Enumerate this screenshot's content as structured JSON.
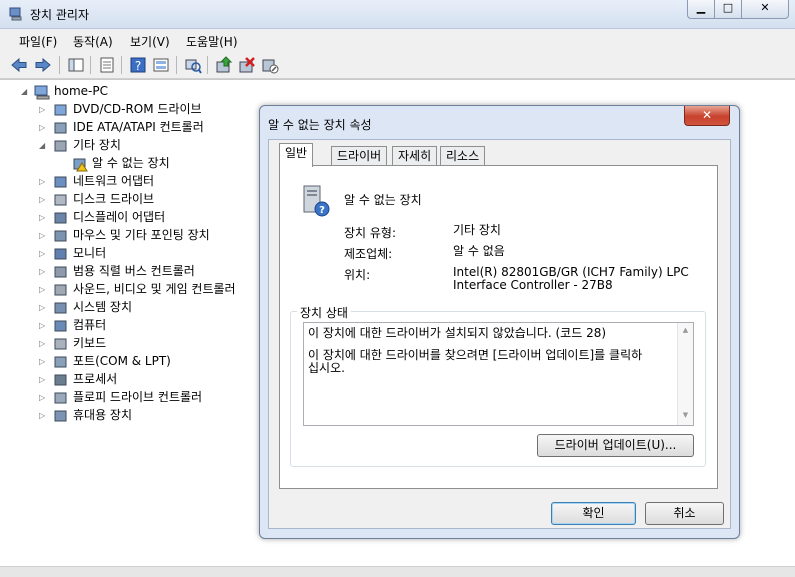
{
  "window": {
    "title": "장치 관리자",
    "controls": {
      "minimize": "▭",
      "maximize": "□",
      "close": "✕"
    }
  },
  "menu": [
    "파일(F)",
    "동작(A)",
    "보기(V)",
    "도움말(H)"
  ],
  "toolbar_icons": [
    "back-icon",
    "forward-icon",
    "show-hide-tree-icon",
    "properties-icon",
    "help-icon",
    "scan-hardware-icon",
    "update-driver-icon",
    "uninstall-icon",
    "disable-icon"
  ],
  "tree": {
    "root": "home-PC",
    "items": [
      {
        "label": "DVD/CD-ROM 드라이브",
        "icon": "dvd-drive-icon"
      },
      {
        "label": "IDE ATA/ATAPI 컨트롤러",
        "icon": "ide-controller-icon"
      },
      {
        "label": "기타 장치",
        "icon": "other-devices-icon",
        "expanded": true
      },
      {
        "label": "알 수 없는 장치",
        "icon": "unknown-device-warning-icon",
        "child": true
      },
      {
        "label": "네트워크 어댑터",
        "icon": "network-adapter-icon"
      },
      {
        "label": "디스크 드라이브",
        "icon": "disk-drive-icon"
      },
      {
        "label": "디스플레이 어댑터",
        "icon": "display-adapter-icon"
      },
      {
        "label": "마우스 및 기타 포인팅 장치",
        "icon": "mouse-icon"
      },
      {
        "label": "모니터",
        "icon": "monitor-icon"
      },
      {
        "label": "범용 직렬 버스 컨트롤러",
        "icon": "usb-icon"
      },
      {
        "label": "사운드, 비디오 및 게임 컨트롤러",
        "icon": "sound-icon"
      },
      {
        "label": "시스템 장치",
        "icon": "system-device-icon"
      },
      {
        "label": "컴퓨터",
        "icon": "computer-icon"
      },
      {
        "label": "키보드",
        "icon": "keyboard-icon"
      },
      {
        "label": "포트(COM & LPT)",
        "icon": "port-icon"
      },
      {
        "label": "프로세서",
        "icon": "processor-icon"
      },
      {
        "label": "플로피 드라이브 컨트롤러",
        "icon": "floppy-controller-icon"
      },
      {
        "label": "휴대용 장치",
        "icon": "portable-device-icon"
      }
    ]
  },
  "dialog": {
    "title": "알 수 없는 장치 속성",
    "close": "✕",
    "tabs": [
      "일반",
      "드라이버",
      "자세히",
      "리소스"
    ],
    "device_name": "알 수 없는 장치",
    "props": {
      "type_label": "장치 유형:",
      "type_value": "기타 장치",
      "manufacturer_label": "제조업체:",
      "manufacturer_value": "알 수 없음",
      "location_label": "위치:",
      "location_value_1": "Intel(R) 82801GB/GR (ICH7 Family) LPC",
      "location_value_2": "Interface Controller - 27B8"
    },
    "status_group": "장치 상태",
    "status_line1": "이 장치에 대한 드라이버가 설치되지 않았습니다. (코드 28)",
    "status_line2a": "이 장치에 대한 드라이버를 찾으려면 [드라이버 업데이트]를 클릭하",
    "status_line2b": "십시오.",
    "update_button": "드라이버 업데이트(U)...",
    "ok": "확인",
    "cancel": "취소"
  }
}
